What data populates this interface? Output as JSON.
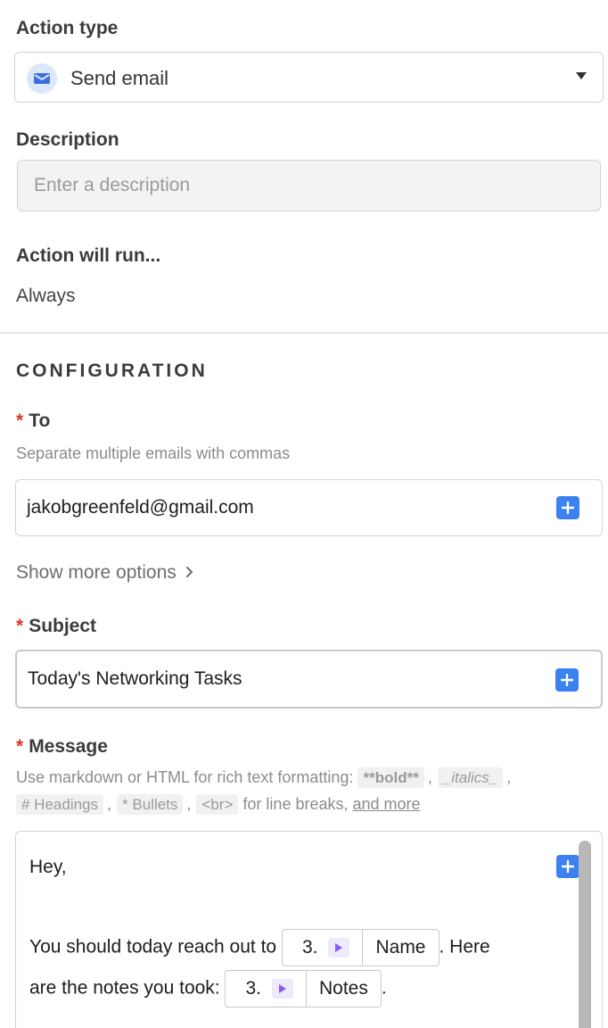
{
  "action_type": {
    "label": "Action type",
    "selected": "Send email",
    "icon": "mail-icon"
  },
  "description": {
    "label": "Description",
    "placeholder": "Enter a description"
  },
  "run": {
    "label": "Action will run...",
    "value": "Always"
  },
  "configuration": {
    "title": "CONFIGURATION",
    "required_mark": "*",
    "to": {
      "label": "To",
      "hint": "Separate multiple emails with commas",
      "value": "jakobgreenfeld@gmail.com"
    },
    "show_more": "Show more options",
    "subject": {
      "label": "Subject",
      "value": "Today's Networking Tasks"
    },
    "message": {
      "label": "Message",
      "hint_prefix": "Use markdown or HTML for rich text formatting:",
      "codes": [
        "**bold**",
        "_italics_",
        "# Headings",
        "* Bullets",
        "<br>"
      ],
      "comma": ",",
      "hint_suffix": "for line breaks,",
      "link": "and more",
      "body": {
        "greeting": "Hey,",
        "line1_prefix": "You should today reach out to",
        "token1": {
          "num": "3.",
          "field": "Name"
        },
        "line1_suffix": ". Here",
        "line2_prefix": "are the notes you took:",
        "token2": {
          "num": "3.",
          "field": "Notes"
        },
        "line2_suffix": "."
      }
    }
  },
  "colors": {
    "accent": "#3b82f0",
    "required": "#d8392b",
    "token_arrow": "#8b5cf6"
  }
}
